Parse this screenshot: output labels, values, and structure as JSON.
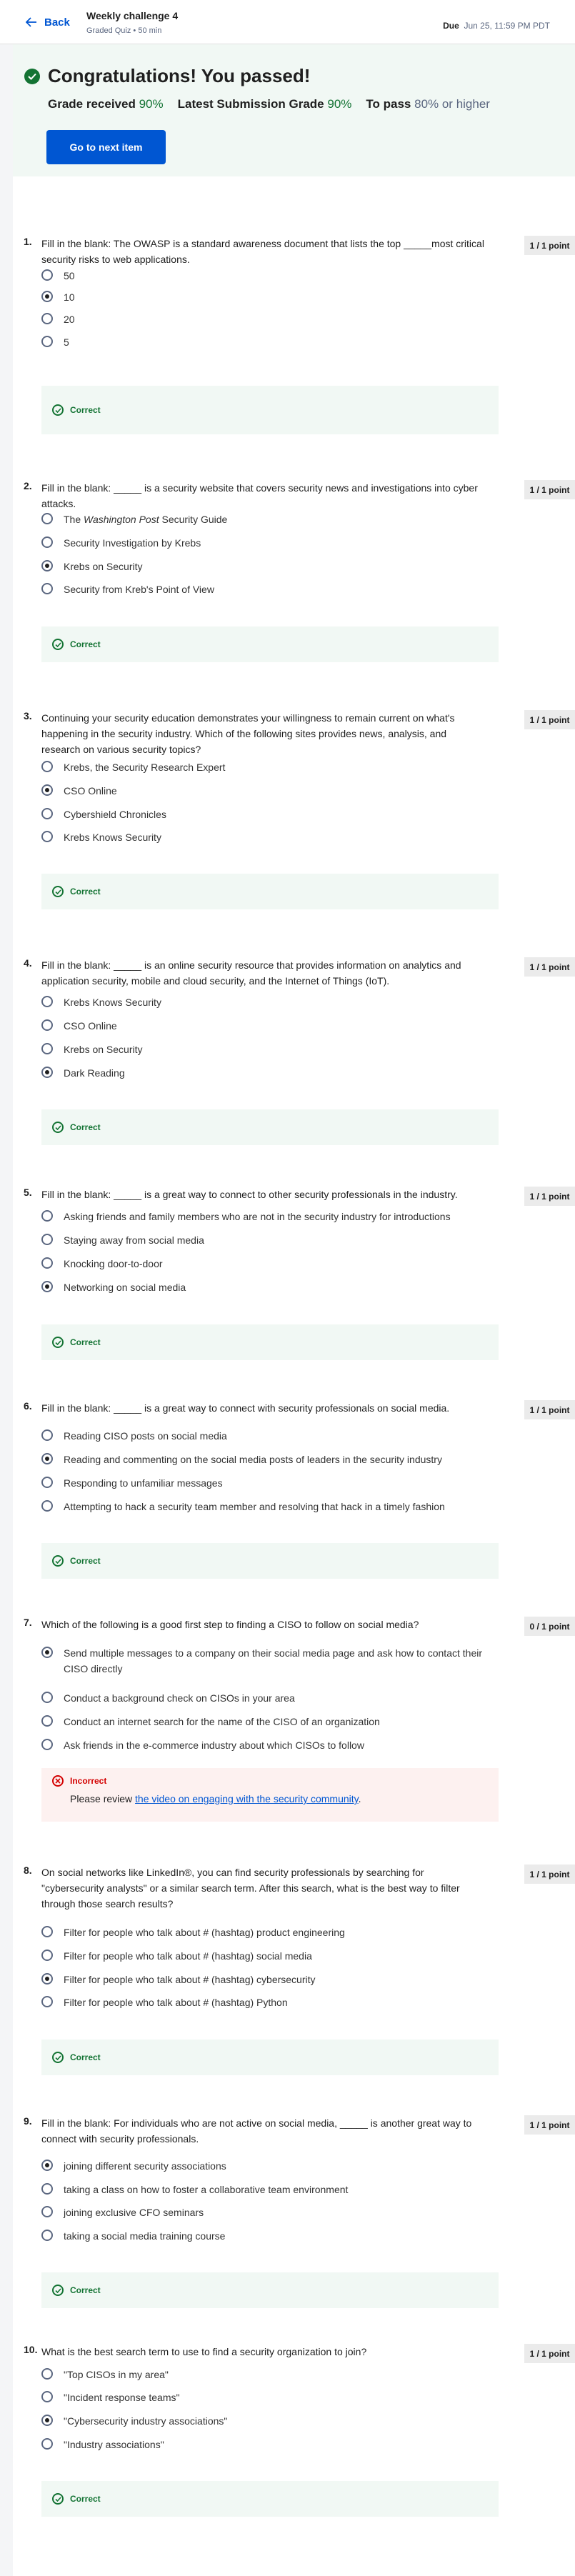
{
  "header": {
    "back_label": "Back",
    "title": "Weekly challenge 4",
    "subtitle": "Graded Quiz • 50 min",
    "due_label": "Due",
    "due_value": "Jun 25, 11:59 PM PDT"
  },
  "banner": {
    "title": "Congratulations! You passed!",
    "grade_label": "Grade received",
    "grade_value": "90%",
    "latest_label": "Latest Submission Grade",
    "latest_value": "90%",
    "pass_label": "To pass",
    "pass_value": "80% or higher",
    "next_button": "Go to next item"
  },
  "questions": [
    {
      "num": "1.",
      "text": "Fill in the blank: The OWASP is a standard awareness document that lists the top _____most critical security risks to web applications.",
      "points": "1 / 1 point",
      "options": [
        "50",
        "10",
        "20",
        "5"
      ],
      "selected": 1,
      "result": "Correct"
    },
    {
      "num": "2.",
      "text": "Fill in the blank: _____ is a security website that covers security news and investigations into cyber attacks.",
      "points": "1 / 1 point",
      "options": [
        "The Washington Post Security Guide",
        "Security Investigation by Krebs",
        "Krebs on Security",
        "Security from Kreb's Point of View"
      ],
      "selected": 2,
      "result": "Correct"
    },
    {
      "num": "3.",
      "text": "Continuing your security education demonstrates your willingness to remain current on what's happening in the security industry. Which of the following sites provides news, analysis, and research on various security topics?",
      "points": "1 / 1 point",
      "options": [
        "Krebs, the Security Research Expert",
        "CSO Online",
        "Cybershield Chronicles",
        "Krebs Knows Security"
      ],
      "selected": 1,
      "result": "Correct"
    },
    {
      "num": "4.",
      "text": "Fill in the blank: _____ is an online security resource that provides information on analytics and application security, mobile and cloud security, and the Internet of Things (IoT).",
      "points": "1 / 1 point",
      "options": [
        "Krebs Knows Security",
        "CSO Online",
        "Krebs on Security",
        "Dark Reading"
      ],
      "selected": 3,
      "result": "Correct"
    },
    {
      "num": "5.",
      "text": "Fill in the blank: _____ is a great way to connect to other security professionals in the industry.",
      "points": "1 / 1 point",
      "options": [
        "Asking friends and family members who are not in the security industry for introductions",
        "Staying away from social media",
        "Knocking door-to-door",
        "Networking on social media"
      ],
      "selected": 3,
      "result": "Correct"
    },
    {
      "num": "6.",
      "text": "Fill in the blank: _____ is a great way to connect with security professionals on social media.",
      "points": "1 / 1 point",
      "options": [
        "Reading CISO posts on social media",
        "Reading and commenting on the social media posts of leaders in the security industry",
        "Responding to unfamiliar messages",
        "Attempting to hack a security team member and resolving that hack in a timely fashion"
      ],
      "selected": 1,
      "result": "Correct"
    },
    {
      "num": "7.",
      "text": "Which of the following is a good first step to finding a CISO to follow on social media?",
      "points": "0 / 1 point",
      "options": [
        "Send multiple messages to a company on their social media page and ask how to contact their CISO directly",
        "Conduct a background check on CISOs in your area",
        "Conduct an internet search for the name of the CISO of an organization",
        "Ask friends in the e-commerce industry about which CISOs to follow"
      ],
      "selected": 0,
      "result": "Incorrect",
      "note_prefix": "Please review ",
      "note_link": "the video on engaging with the security community",
      "note_suffix": "."
    },
    {
      "num": "8.",
      "text": "On social networks like LinkedIn®, you can find security professionals by searching for \"cybersecurity analysts\" or a similar search term. After this search, what is the best way to filter through those search results?",
      "points": "1 / 1 point",
      "options": [
        "Filter for people who talk about # (hashtag) product engineering",
        "Filter for people who talk about # (hashtag) social media",
        "Filter for people who talk about # (hashtag) cybersecurity",
        "Filter for people who talk about # (hashtag) Python"
      ],
      "selected": 2,
      "result": "Correct"
    },
    {
      "num": "9.",
      "text": "Fill in the blank: For individuals who are not active on social media, _____ is another great way to connect with security professionals.",
      "points": "1 / 1 point",
      "options": [
        "joining different security associations",
        "taking a class on how to foster a collaborative team environment",
        "joining exclusive CFO seminars",
        "taking a social media training course"
      ],
      "selected": 0,
      "result": "Correct"
    },
    {
      "num": "10.",
      "text": "What is the best search term to use to find a security organization to join?",
      "points": "1 / 1 point",
      "options": [
        "\"Top CISOs in my area\"",
        "\"Incident response teams\"",
        "\"Cybersecurity industry associations\"",
        "\"Industry associations\""
      ],
      "selected": 2,
      "result": "Correct"
    }
  ],
  "colors": {
    "accent": "#0056d2",
    "success": "#137333",
    "error": "#d30001"
  }
}
